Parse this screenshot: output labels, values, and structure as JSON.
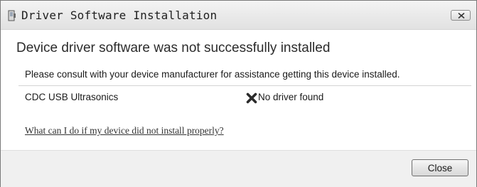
{
  "window": {
    "title": "Driver Software Installation",
    "icons": {
      "title_icon": "device-installation-icon",
      "close_icon": "close-icon"
    }
  },
  "main": {
    "heading": "Device driver software was not successfully installed",
    "message": "Please consult with your device manufacturer for assistance getting this device installed.",
    "devices": [
      {
        "name": "CDC USB Ultrasonics",
        "status_icon": "error-x-icon",
        "status": "No driver found"
      }
    ],
    "help_link": "What can I do if my device did not install properly?"
  },
  "footer": {
    "close_label": "Close"
  }
}
